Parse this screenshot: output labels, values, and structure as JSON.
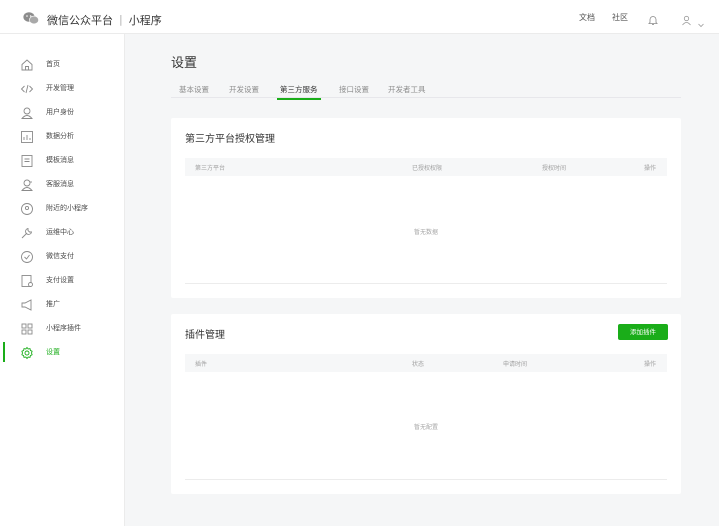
{
  "header": {
    "brand": "微信公众平台",
    "divider": "|",
    "product": "小程序",
    "links": {
      "docs": "文档",
      "community": "社区"
    },
    "icons": [
      "wechat-logo-icon",
      "bell-icon",
      "avatar-icon",
      "chevron-down-icon"
    ]
  },
  "sidebar": {
    "items": [
      {
        "label": "首页",
        "icon": "home-icon"
      },
      {
        "label": "开发管理",
        "icon": "code-icon"
      },
      {
        "label": "用户身份",
        "icon": "user-icon"
      },
      {
        "label": "数据分析",
        "icon": "chart-icon"
      },
      {
        "label": "模板消息",
        "icon": "template-icon"
      },
      {
        "label": "客服消息",
        "icon": "support-icon"
      },
      {
        "label": "附近的小程序",
        "icon": "location-icon"
      },
      {
        "label": "运维中心",
        "icon": "wrench-icon"
      },
      {
        "label": "微信支付",
        "icon": "pay-icon"
      },
      {
        "label": "支付设置",
        "icon": "payment-settings-icon"
      },
      {
        "label": "推广",
        "icon": "megaphone-icon"
      },
      {
        "label": "小程序插件",
        "icon": "plugin-icon"
      },
      {
        "label": "设置",
        "icon": "gear-icon"
      }
    ],
    "active_index": 12,
    "accent_color": "#1aad19"
  },
  "main": {
    "title": "设置",
    "tabs": [
      "基本设置",
      "开发设置",
      "第三方服务",
      "接口设置",
      "开发者工具"
    ],
    "active_tab": 2,
    "third_party": {
      "title": "第三方平台授权管理",
      "columns": [
        "第三方平台",
        "已授权权限",
        "授权时间",
        "操作"
      ],
      "empty_text": "暂无数据"
    },
    "plugins": {
      "title": "插件管理",
      "add_button": "添加插件",
      "columns": [
        "插件",
        "状态",
        "申请时间",
        "操作"
      ],
      "empty_text": "暂无配置"
    }
  }
}
